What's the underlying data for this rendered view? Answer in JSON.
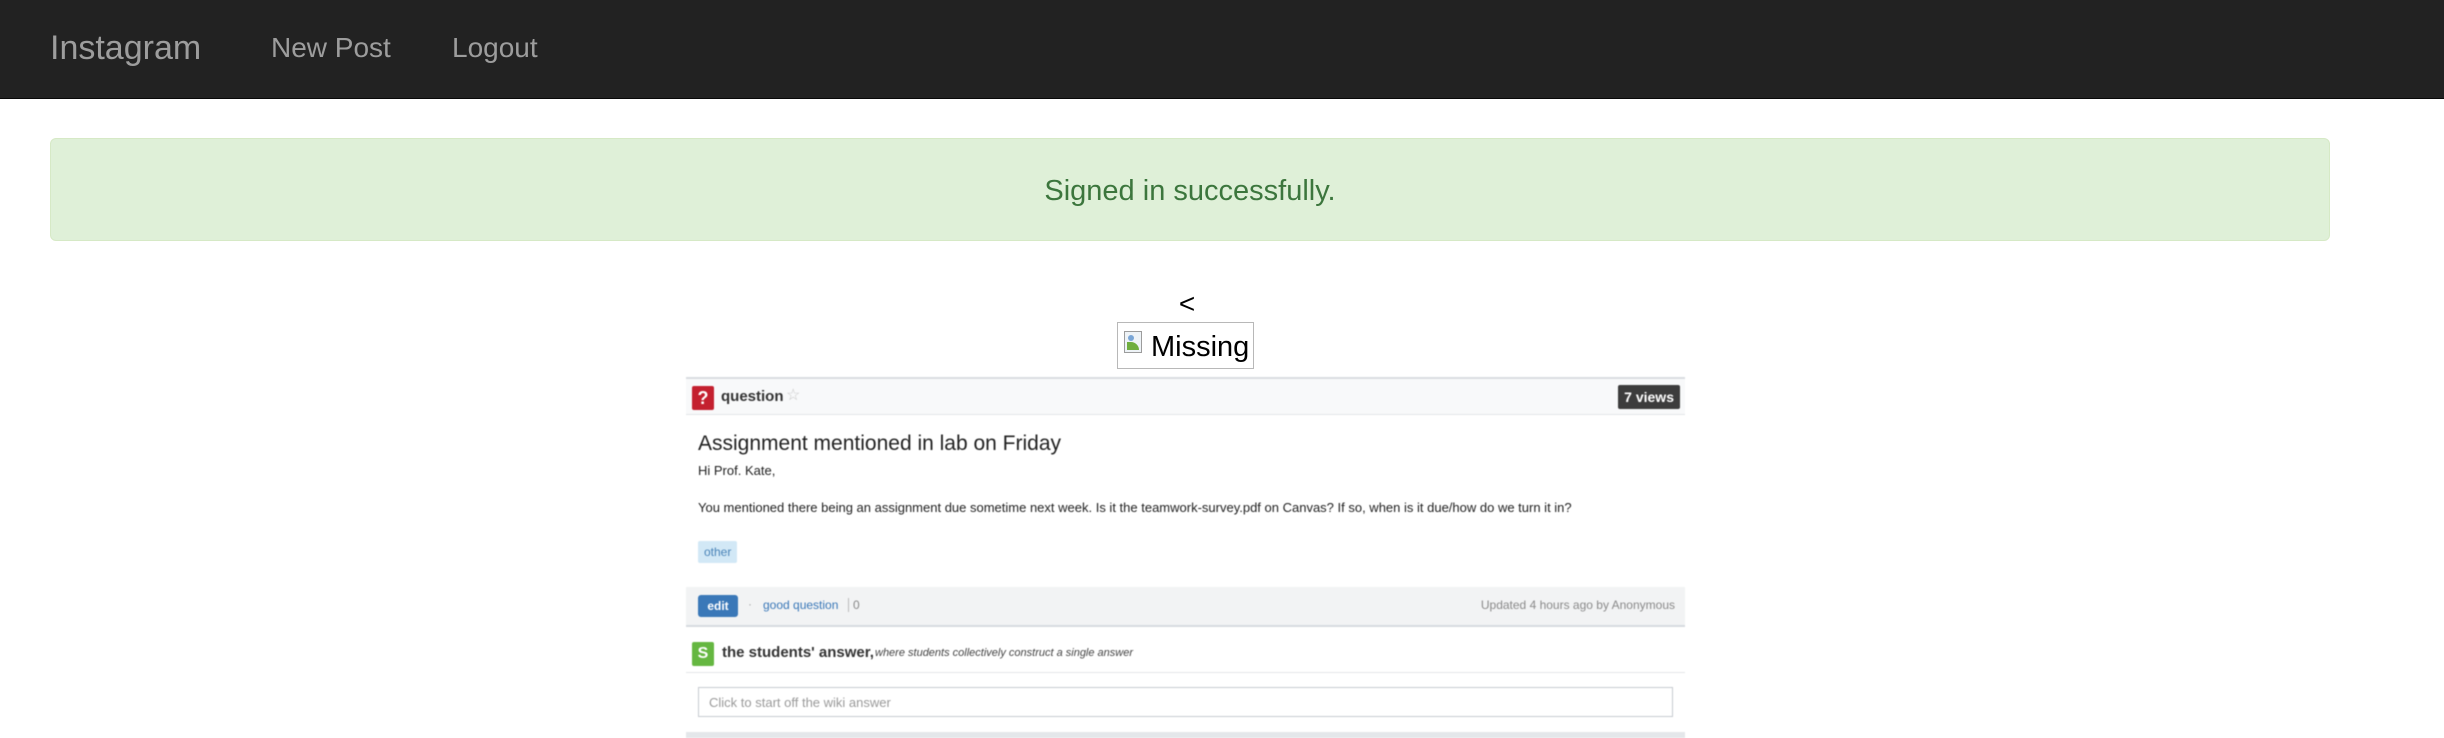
{
  "navbar": {
    "brand": "Instagram",
    "links": [
      "New Post",
      "Logout"
    ]
  },
  "flash": {
    "message": "Signed in successfully."
  },
  "post": {
    "prev_arrow": "<",
    "image_alt": "Missing"
  },
  "screenshot": {
    "type_label": "question",
    "views": "7 views",
    "title": "Assignment mentioned in lab on Friday",
    "greeting": "Hi Prof. Kate,",
    "body": "You mentioned there being an assignment due sometime next week. Is it the teamwork-survey.pdf on Canvas? If so, when is it due/how do we turn it in?",
    "tag": "other",
    "edit_label": "edit",
    "good_question_label": "good question",
    "good_question_count": "0",
    "updated": "Updated 4 hours ago by Anonymous",
    "students_answer_label": "the students' answer,",
    "students_answer_sub": "where students collectively construct a single answer",
    "wiki_placeholder": "Click to start off the wiki answer"
  },
  "colors": {
    "navbar_bg": "#222222",
    "nav_text": "#9d9d9d",
    "flash_bg": "#dff0d8",
    "flash_text": "#3c763d"
  }
}
